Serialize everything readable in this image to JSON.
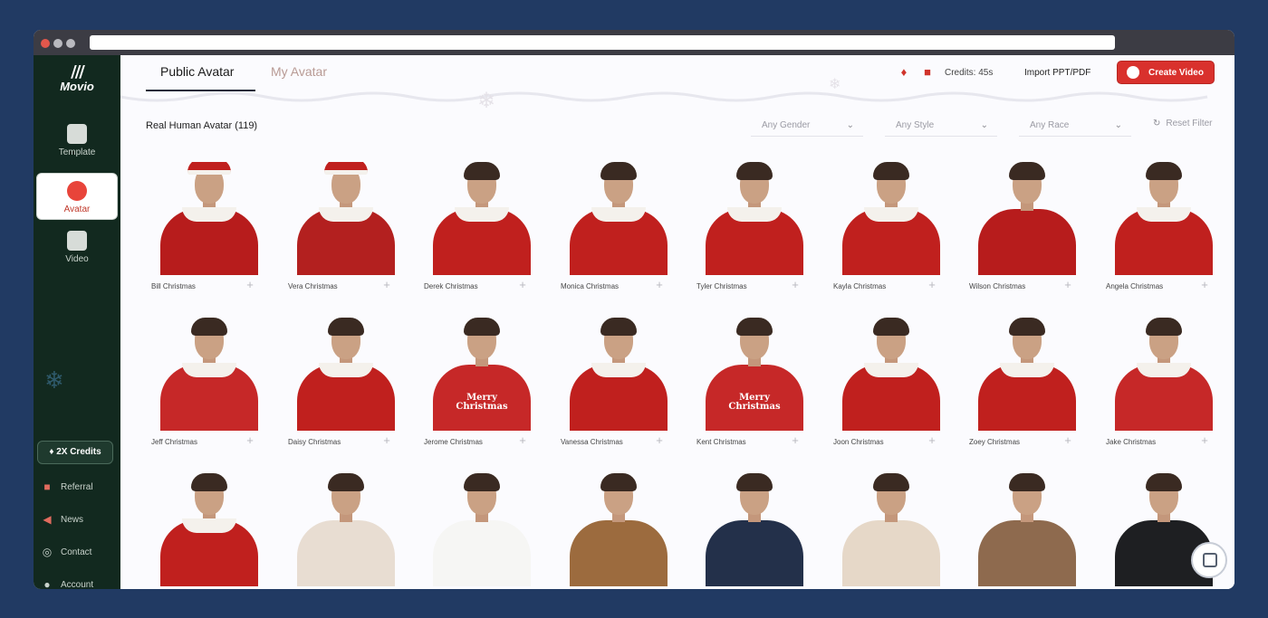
{
  "app": {
    "brand_name": "Movio"
  },
  "sidebar": {
    "nav": [
      {
        "label": "Template"
      },
      {
        "label": "Avatar"
      },
      {
        "label": "Video"
      }
    ],
    "credits_badge": "2X Credits",
    "links": [
      {
        "label": "Referral",
        "icon": "gift-icon"
      },
      {
        "label": "News",
        "icon": "megaphone-icon"
      },
      {
        "label": "Contact",
        "icon": "headset-icon"
      },
      {
        "label": "Account",
        "icon": "user-icon"
      }
    ]
  },
  "header": {
    "tabs": [
      {
        "label": "Public Avatar",
        "active": true
      },
      {
        "label": "My Avatar",
        "active": false
      }
    ],
    "credits": "Credits: 45s",
    "import_label": "Import PPT/PDF",
    "create_label": "Create Video",
    "accent_color": "#d9312d"
  },
  "toolbar": {
    "section_title": "Real Human Avatar (119)",
    "filters": [
      {
        "label": "Any Gender"
      },
      {
        "label": "Any Style"
      },
      {
        "label": "Any Race"
      }
    ],
    "reset_label": "Reset Filter"
  },
  "avatars": [
    {
      "name": "Bill Christmas",
      "outfit": "santa"
    },
    {
      "name": "Vera Christmas",
      "outfit": "santa-dress"
    },
    {
      "name": "Derek Christmas",
      "outfit": "red-collar"
    },
    {
      "name": "Monica Christmas",
      "outfit": "red-collar"
    },
    {
      "name": "Tyler Christmas",
      "outfit": "red-collar"
    },
    {
      "name": "Kayla Christmas",
      "outfit": "red-collar"
    },
    {
      "name": "Wilson Christmas",
      "outfit": "red-suit"
    },
    {
      "name": "Angela Christmas",
      "outfit": "red-collar"
    },
    {
      "name": "Jeff Christmas",
      "outfit": "sweater"
    },
    {
      "name": "Daisy Christmas",
      "outfit": "red-collar"
    },
    {
      "name": "Jerome Christmas",
      "outfit": "merry-shirt",
      "print": "Merry Christmas"
    },
    {
      "name": "Vanessa Christmas",
      "outfit": "red-collar"
    },
    {
      "name": "Kent Christmas",
      "outfit": "merry-shirt",
      "print": "Merry Christmas"
    },
    {
      "name": "Joon Christmas",
      "outfit": "red-collar"
    },
    {
      "name": "Zoey Christmas",
      "outfit": "red-collar"
    },
    {
      "name": "Jake Christmas",
      "outfit": "sweater"
    },
    {
      "name": "",
      "outfit": "red-collar"
    },
    {
      "name": "",
      "outfit": "beige-blazer"
    },
    {
      "name": "",
      "outfit": "white-top"
    },
    {
      "name": "",
      "outfit": "leopard"
    },
    {
      "name": "",
      "outfit": "navy-suit"
    },
    {
      "name": "",
      "outfit": "beige-sweater"
    },
    {
      "name": "",
      "outfit": "floral-shirt"
    },
    {
      "name": "",
      "outfit": "black-suit"
    }
  ]
}
